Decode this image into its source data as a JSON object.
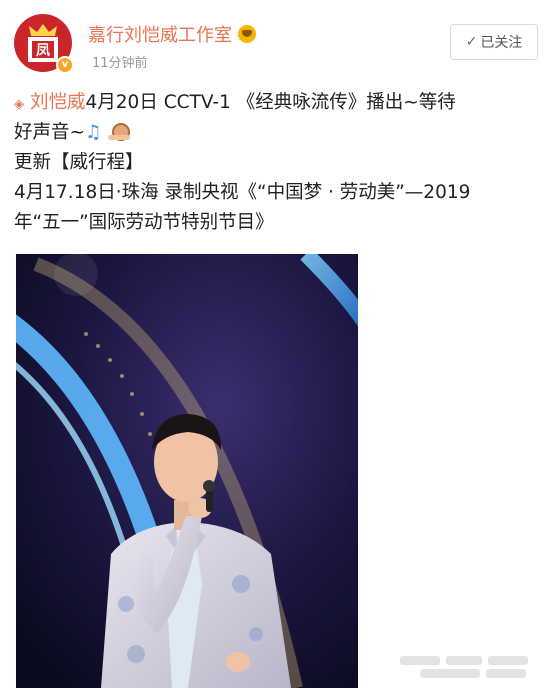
{
  "header": {
    "user_name": "嘉行刘恺威工作室",
    "post_time": "11分钟前",
    "follow_label": "已关注",
    "avatar_icon": "studio-logo",
    "verified_icon": "verified-v-badge",
    "vip_icon": "crown-emoji-badge"
  },
  "post": {
    "line1_mention": "刘恺威",
    "line1_text": "4月20日  CCTV-1 《经典咏流传》播出~等待",
    "line2_text": "好声音~",
    "line3_text": "更新【威行程】",
    "line4_text": "4月17.18日·珠海 录制央视《“中国梦 · 劳动美”—2019",
    "line5_text": "年“五一”国际劳动节特别节目》",
    "icons": [
      "super-topic-icon",
      "music-note-icon",
      "snail-emoji"
    ]
  },
  "colors": {
    "brand": "#eb7350",
    "avatar_red": "#c9252b",
    "verified_gold": "#f5a623"
  },
  "image": {
    "subject": "singer-on-stage-photo"
  }
}
